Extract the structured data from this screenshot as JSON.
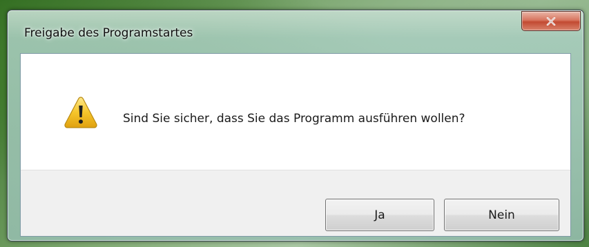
{
  "window": {
    "title": "Freigabe des Programstartes"
  },
  "titlebar": {
    "close_icon": "close-x-icon",
    "close_color": "#c24a32"
  },
  "dialog": {
    "icon": "warning-icon",
    "message": "Sind Sie sicher, dass Sie das Programm ausführen wollen?"
  },
  "buttons": {
    "yes_label": "Ja",
    "no_label": "Nein"
  },
  "colors": {
    "content_bg": "#ffffff",
    "button_bar_bg": "#f0f0f0",
    "warning_yellow": "#f6c52b"
  }
}
